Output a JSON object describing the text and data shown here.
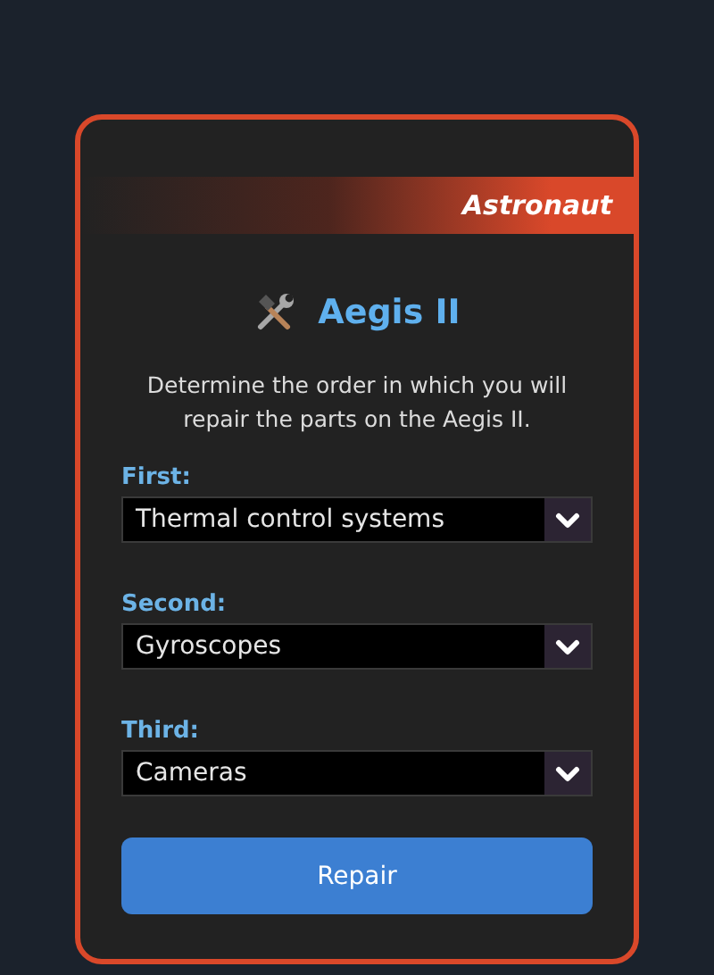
{
  "ribbon": {
    "label": "Astronaut"
  },
  "title": "Aegis II",
  "description": "Determine the order in which you will repair the parts on the Aegis II.",
  "selects": [
    {
      "label": "First:",
      "value": "Thermal control systems"
    },
    {
      "label": "Second:",
      "value": "Gyroscopes"
    },
    {
      "label": "Third:",
      "value": "Cameras"
    }
  ],
  "button": "Repair"
}
